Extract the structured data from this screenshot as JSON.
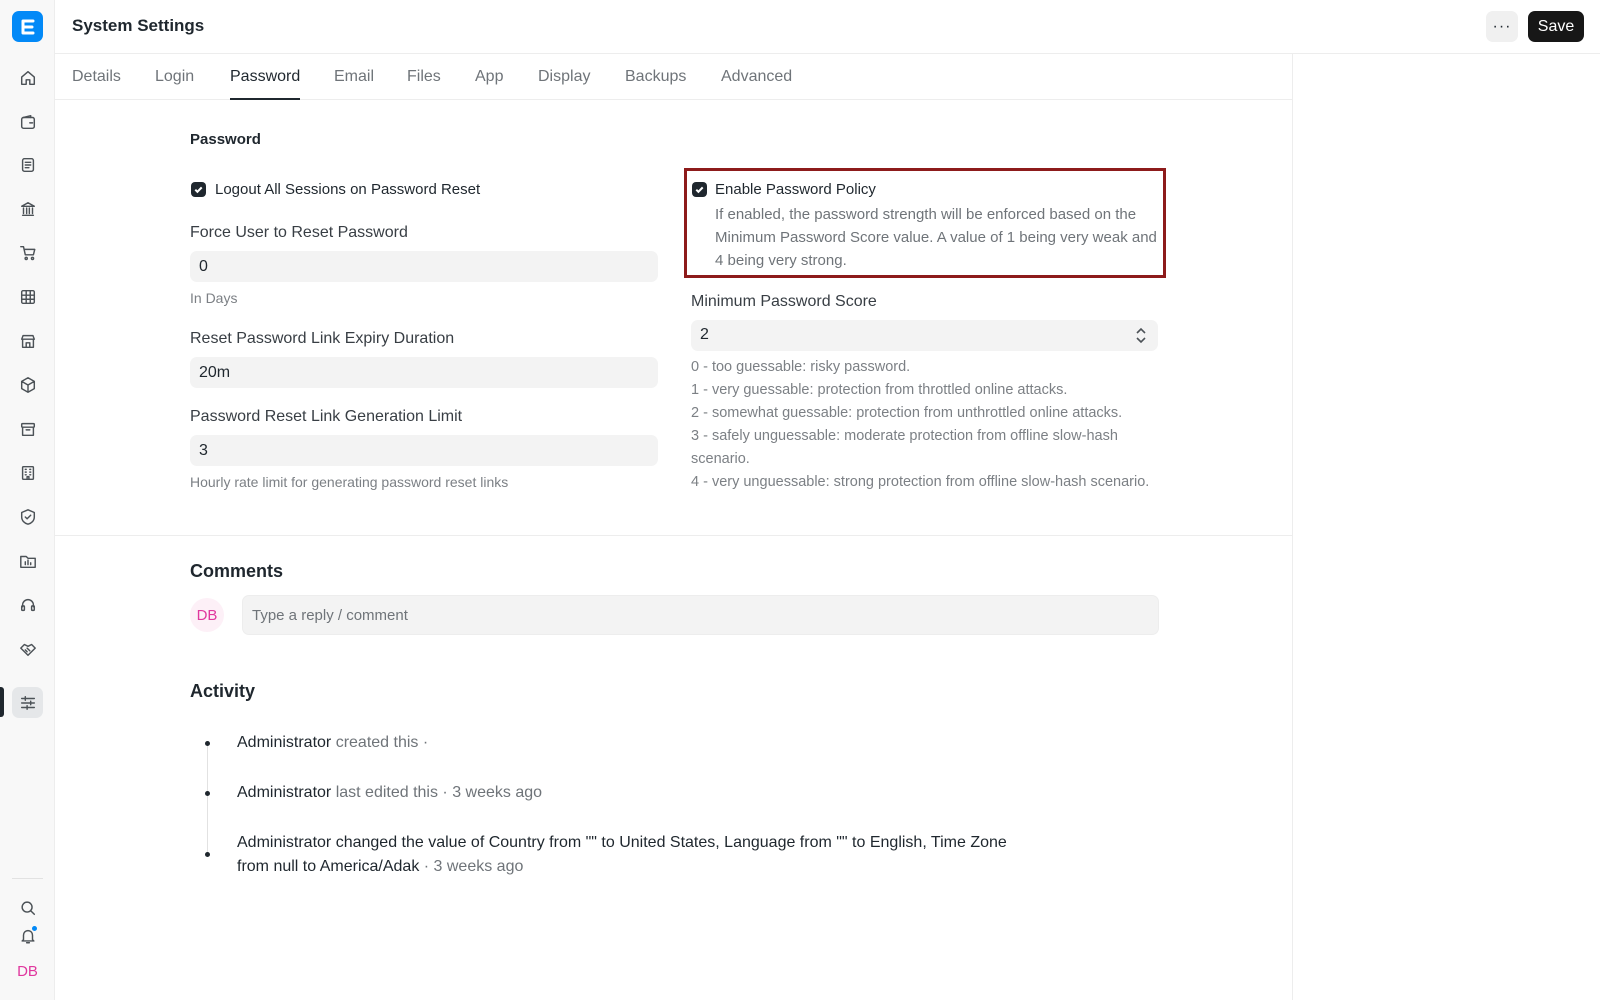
{
  "header": {
    "title": "System Settings",
    "more_label": "···",
    "save_label": "Save"
  },
  "tabs": [
    "Details",
    "Login",
    "Password",
    "Email",
    "Files",
    "App",
    "Display",
    "Backups",
    "Advanced"
  ],
  "active_tab": "Password",
  "sidebar": {
    "icons": [
      "home-icon",
      "wallet-icon",
      "document-icon",
      "bank-icon",
      "cart-icon",
      "table-icon",
      "store-icon",
      "package-icon",
      "archive-icon",
      "building-icon",
      "shield-icon",
      "folder-chart-icon",
      "headset-icon",
      "handshake-icon",
      "sliders-icon"
    ],
    "bottom_icons": [
      "search-icon",
      "bell-icon"
    ],
    "user_initials": "DB",
    "accent": "#0289f7"
  },
  "password_section": {
    "title": "Password",
    "logout_all": {
      "label": "Logout All Sessions on Password Reset",
      "checked": true
    },
    "force_reset": {
      "label": "Force User to Reset Password",
      "value": "0",
      "help": "In Days"
    },
    "expiry": {
      "label": "Reset Password Link Expiry Duration",
      "value": "20m"
    },
    "gen_limit": {
      "label": "Password Reset Link Generation Limit",
      "value": "3",
      "help": "Hourly rate limit for generating password reset links"
    },
    "policy": {
      "label": "Enable Password Policy",
      "checked": true,
      "help": "If enabled, the password strength will be enforced based on the Minimum Password Score value. A value of 1 being very weak and 4 being very strong."
    },
    "min_score": {
      "label": "Minimum Password Score",
      "value": "2",
      "help": [
        "0 - too guessable: risky password.",
        "1 - very guessable: protection from throttled online attacks.",
        "2 - somewhat guessable: protection from unthrottled online attacks.",
        "3 - safely unguessable: moderate protection from offline slow-hash scenario.",
        "4 - very unguessable: strong protection from offline slow-hash scenario."
      ]
    }
  },
  "comments": {
    "title": "Comments",
    "avatar": "DB",
    "placeholder": "Type a reply / comment"
  },
  "activity": {
    "title": "Activity",
    "items": [
      {
        "user": "Administrator",
        "text": "created this ·"
      },
      {
        "user": "Administrator",
        "text": "last edited this · 3 weeks ago"
      }
    ],
    "change": {
      "user": "Administrator",
      "p1": " changed the value of Country from \"\" to ",
      "v1": "United States",
      "p2": ", Language from \"\" to ",
      "v2": "English",
      "p3": ", Time Zone from ",
      "v3": "null",
      "p4": " to ",
      "v4": "America/Adak",
      "time": " · 3 weeks ago"
    }
  }
}
